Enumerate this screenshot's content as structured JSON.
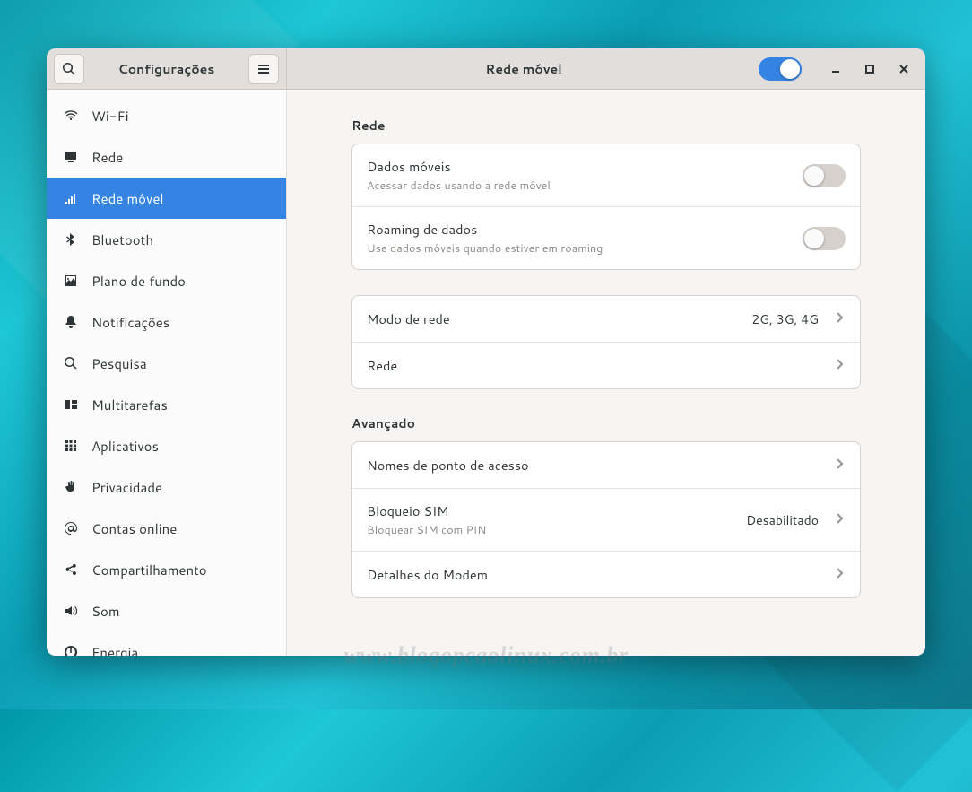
{
  "header": {
    "left_title": "Configurações",
    "right_title": "Rede móvel",
    "master_switch_on": true
  },
  "sidebar": {
    "items": [
      {
        "id": "wifi",
        "label": "Wi-Fi",
        "icon": "wifi",
        "chevron": false
      },
      {
        "id": "rede",
        "label": "Rede",
        "icon": "display",
        "chevron": false
      },
      {
        "id": "rede-movel",
        "label": "Rede móvel",
        "icon": "signal",
        "chevron": false,
        "active": true
      },
      {
        "id": "bluetooth",
        "label": "Bluetooth",
        "icon": "bluetooth",
        "chevron": false
      },
      {
        "id": "plano-fundo",
        "label": "Plano de fundo",
        "icon": "picture",
        "chevron": false
      },
      {
        "id": "notificacoes",
        "label": "Notificações",
        "icon": "bell",
        "chevron": false
      },
      {
        "id": "pesquisa",
        "label": "Pesquisa",
        "icon": "search",
        "chevron": false
      },
      {
        "id": "multitarefas",
        "label": "Multitarefas",
        "icon": "multitask",
        "chevron": false
      },
      {
        "id": "aplicativos",
        "label": "Aplicativos",
        "icon": "grid",
        "chevron": true
      },
      {
        "id": "privacidade",
        "label": "Privacidade",
        "icon": "hand",
        "chevron": true
      },
      {
        "id": "contas",
        "label": "Contas online",
        "icon": "at",
        "chevron": false
      },
      {
        "id": "compart",
        "label": "Compartilhamento",
        "icon": "share",
        "chevron": false
      },
      {
        "id": "som",
        "label": "Som",
        "icon": "sound",
        "chevron": false
      },
      {
        "id": "energia",
        "label": "Energia",
        "icon": "power",
        "chevron": false
      }
    ]
  },
  "sections": {
    "rede": {
      "title": "Rede",
      "rows": [
        {
          "id": "dados-moveis",
          "title": "Dados móveis",
          "subtitle": "Acessar dados usando a rede móvel",
          "switch": false
        },
        {
          "id": "roaming",
          "title": "Roaming de dados",
          "subtitle": "Use dados móveis quando estiver em roaming",
          "switch": false
        }
      ]
    },
    "modo": {
      "rows": [
        {
          "id": "modo-rede",
          "title": "Modo de rede",
          "value": "2G, 3G, 4G",
          "chevron": true
        },
        {
          "id": "rede-sel",
          "title": "Rede",
          "chevron": true
        }
      ]
    },
    "avancado": {
      "title": "Avançado",
      "rows": [
        {
          "id": "apn",
          "title": "Nomes de ponto de acesso",
          "chevron": true
        },
        {
          "id": "sim",
          "title": "Bloqueio SIM",
          "subtitle": "Bloquear SIM com PIN",
          "value": "Desabilitado",
          "chevron": true
        },
        {
          "id": "modem",
          "title": "Detalhes do Modem",
          "chevron": true
        }
      ]
    }
  },
  "watermark": "www.blogopcaolinux.com.br"
}
